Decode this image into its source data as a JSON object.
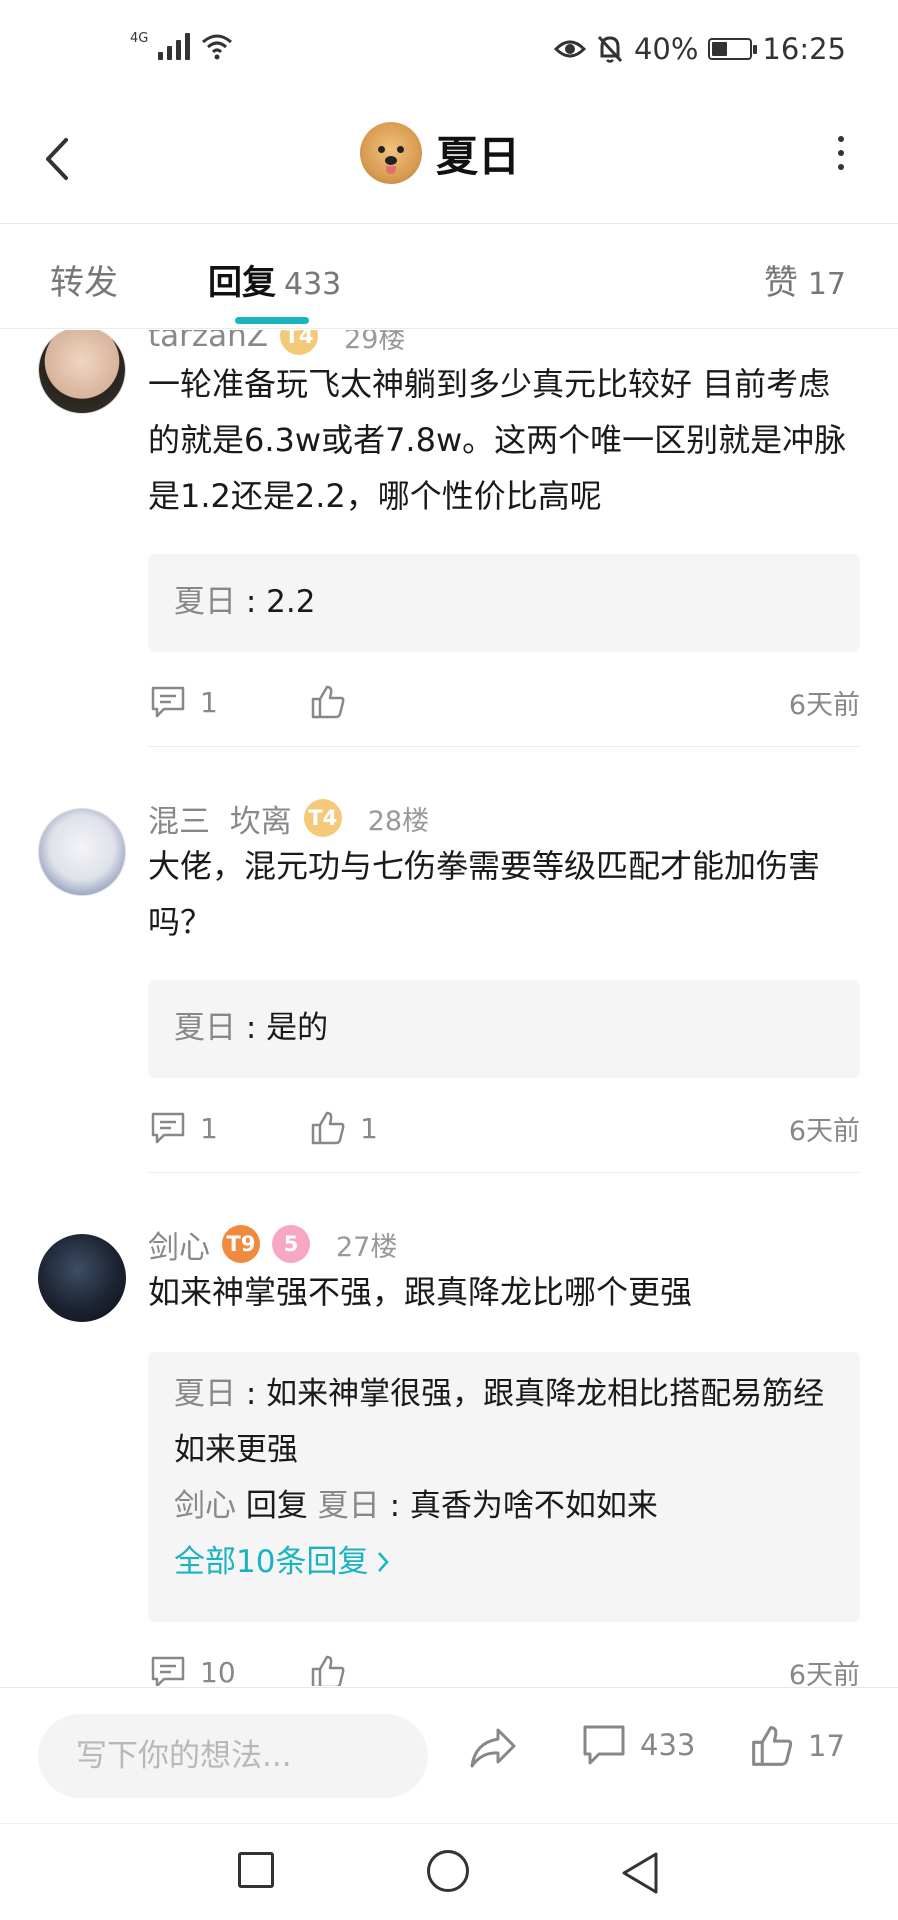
{
  "status_bar": {
    "network": "4G",
    "battery": "40%",
    "battery_level": 0.4,
    "time": "16:25"
  },
  "header": {
    "title": "夏日"
  },
  "tabs": {
    "forward": "转发",
    "reply": "回复",
    "reply_count": "433",
    "like": "赞",
    "like_count": "17"
  },
  "comments": [
    {
      "username": "tarzanZ",
      "badges": [
        "T4"
      ],
      "floor": "29楼",
      "text": "一轮准备玩飞太神躺到多少真元比较好 目前考虑的就是6.3w或者7.8w。这两个唯一区别就是冲脉是1.2还是2.2，哪个性价比高呢",
      "replies": [
        {
          "author": "夏日",
          "sep": " : ",
          "text": "2.2"
        }
      ],
      "reply_count": "1",
      "like_count": "",
      "time": "6天前"
    },
    {
      "username": "混三  坎离",
      "badges": [
        "T4"
      ],
      "floor": "28楼",
      "text": "大佬，混元功与七伤拳需要等级匹配才能加伤害吗？",
      "replies": [
        {
          "author": "夏日",
          "sep": " : ",
          "text": "是的"
        }
      ],
      "reply_count": "1",
      "like_count": "1",
      "time": "6天前"
    },
    {
      "username": "剑心",
      "badges": [
        "T9",
        "5"
      ],
      "floor": "27楼",
      "text": "如来神掌强不强，跟真降龙比哪个更强",
      "replies": [
        {
          "author": "夏日",
          "sep": " : ",
          "text": "如来神掌很强，跟真降龙相比搭配易筋经如来更强"
        },
        {
          "author": "剑心",
          "mid": " 回复 ",
          "target": "夏日",
          "sep": " : ",
          "text": "真香为啥不如如来"
        }
      ],
      "all_replies": "全部10条回复",
      "reply_count": "10",
      "like_count": "",
      "time": "6天前"
    }
  ],
  "bottom_bar": {
    "input_placeholder": "写下你的想法...",
    "comment_count": "433",
    "like_count": "17"
  },
  "icons": [
    "back-icon",
    "more-icon",
    "comment-icon",
    "thumb-up-icon",
    "share-icon",
    "chevron-right-icon",
    "eye-icon",
    "bell-off-icon",
    "wifi-icon",
    "battery-icon"
  ],
  "colors": {
    "accent": "#19b4c0",
    "muted": "#888888",
    "reply_bg": "#f5f5f5"
  }
}
